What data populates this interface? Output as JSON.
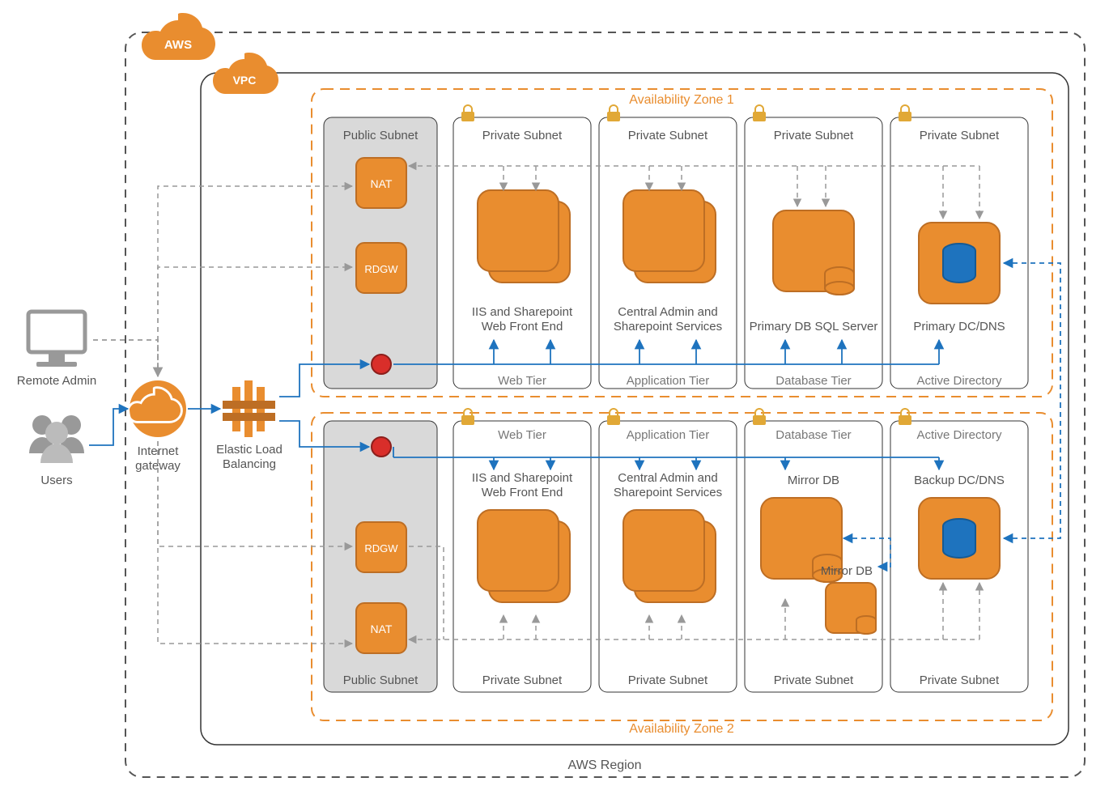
{
  "cloud": {
    "aws": "AWS",
    "vpc": "VPC"
  },
  "region": "AWS Region",
  "az1": "Availability Zone 1",
  "az2": "Availability Zone 2",
  "external": {
    "remote_admin": "Remote Admin",
    "users": "Users",
    "igw": "Internet\ngateway",
    "elb": "Elastic Load\nBalancing"
  },
  "colors": {
    "orange": "#E98D2F",
    "orange_dark": "#BD6E24",
    "blue": "#1E73BE",
    "gray": "#999999",
    "red": "#D92E2A"
  },
  "zone1": {
    "public": {
      "title": "Public Subnet",
      "nat": "NAT",
      "rdgw": "RDGW"
    },
    "web": {
      "title": "Private Subnet",
      "tier": "Web Tier",
      "service": "IIS and Sharepoint\nWeb Front End"
    },
    "app": {
      "title": "Private Subnet",
      "tier": "Application Tier",
      "service": "Central Admin and\nSharepoint Services"
    },
    "db": {
      "title": "Private Subnet",
      "tier": "Database Tier",
      "service": "Primary DB SQL Server"
    },
    "ad": {
      "title": "Private Subnet",
      "tier": "Active Directory",
      "service": "Primary DC/DNS"
    }
  },
  "zone2": {
    "public": {
      "title": "Public Subnet",
      "nat": "NAT",
      "rdgw": "RDGW"
    },
    "web": {
      "title": "Private Subnet",
      "tier": "Web Tier",
      "service": "IIS and Sharepoint\nWeb Front End"
    },
    "app": {
      "title": "Private Subnet",
      "tier": "Application Tier",
      "service": "Central Admin and\nSharepoint Services"
    },
    "db": {
      "title": "Private Subnet",
      "tier": "Database Tier",
      "service": "Mirror DB",
      "witness": "Mirror DB"
    },
    "ad": {
      "title": "Private Subnet",
      "tier": "Active Directory",
      "service": "Backup DC/DNS"
    }
  }
}
